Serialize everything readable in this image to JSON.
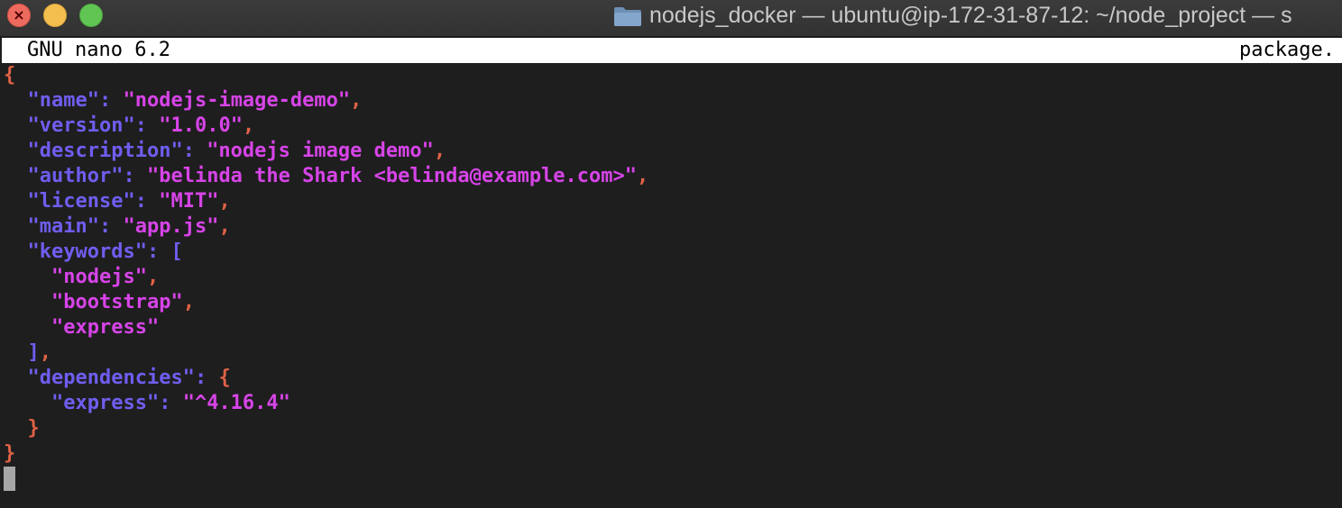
{
  "window": {
    "title": "nodejs_docker — ubuntu@ip-172-31-87-12: ~/node_project — s"
  },
  "nano": {
    "version_label": "GNU nano 6.2",
    "filename": "package."
  },
  "editor": {
    "open_brace": "{",
    "name_key": "\"name\"",
    "name_value": "\"nodejs-image-demo\"",
    "version_key": "\"version\"",
    "version_value": "\"1.0.0\"",
    "description_key": "\"description\"",
    "description_value": "\"nodejs image demo\"",
    "author_key": "\"author\"",
    "author_value": "\"belinda the Shark <belinda@example.com>\"",
    "license_key": "\"license\"",
    "license_value": "\"MIT\"",
    "main_key": "\"main\"",
    "main_value": "\"app.js\"",
    "keywords_key": "\"keywords\"",
    "keywords_open": "[",
    "keyword_1": "\"nodejs\"",
    "keyword_2": "\"bootstrap\"",
    "keyword_3": "\"express\"",
    "keywords_close": "]",
    "dependencies_key": "\"dependencies\"",
    "dependencies_open": "{",
    "dep_express_key": "\"express\"",
    "dep_express_value": "\"^4.16.4\"",
    "dependencies_close": "}",
    "close_brace": "}"
  },
  "colors": {
    "key": "#6f5ef0",
    "string": "#d744e8",
    "brace": "#e06246",
    "background": "#1e1e1e"
  }
}
